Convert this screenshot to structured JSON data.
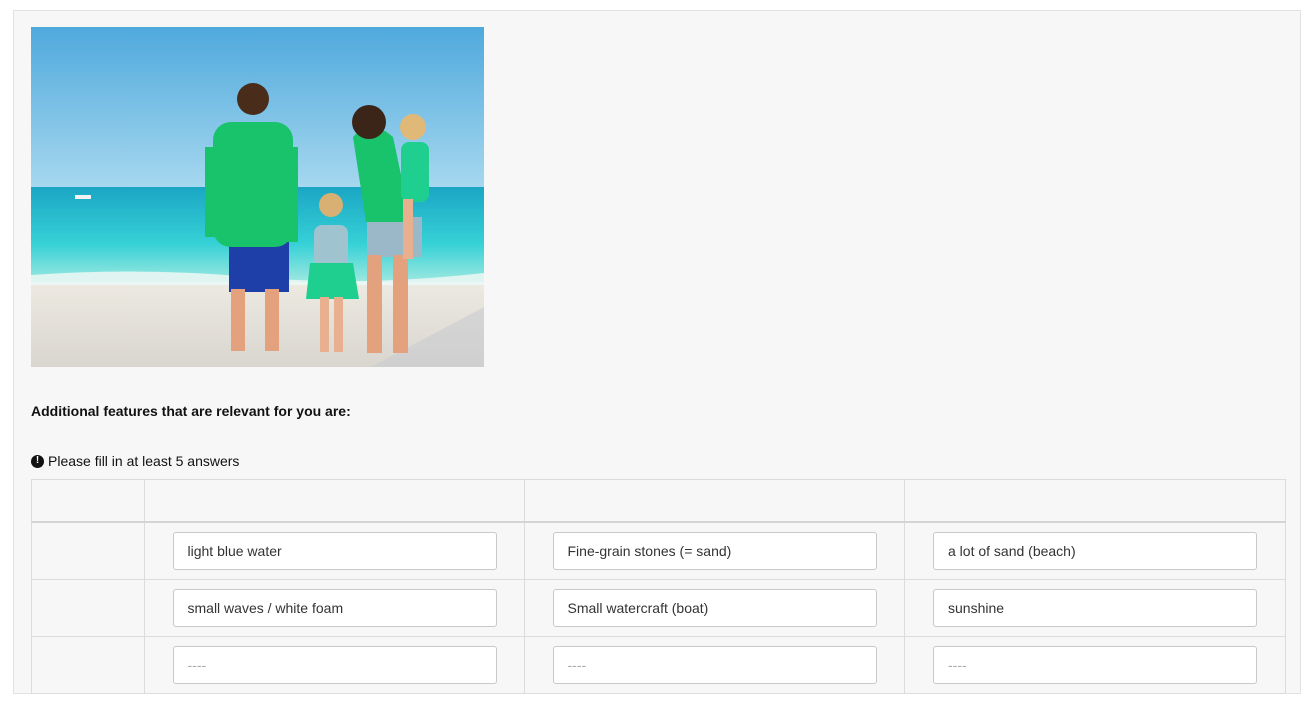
{
  "question": {
    "label": "Additional features that are relevant for you are:"
  },
  "notice": {
    "text": "Please fill in at least 5 answers"
  },
  "grid": {
    "rows": [
      {
        "answers": [
          "light blue water",
          "Fine-grain stones (= sand)",
          "a lot of sand (beach)"
        ]
      },
      {
        "answers": [
          "small waves / white foam",
          "Small watercraft (boat)",
          "sunshine"
        ]
      },
      {
        "answers": [
          "",
          "",
          ""
        ]
      }
    ],
    "placeholder": "----"
  },
  "photo": {
    "subject": "family-on-beach-photo"
  }
}
